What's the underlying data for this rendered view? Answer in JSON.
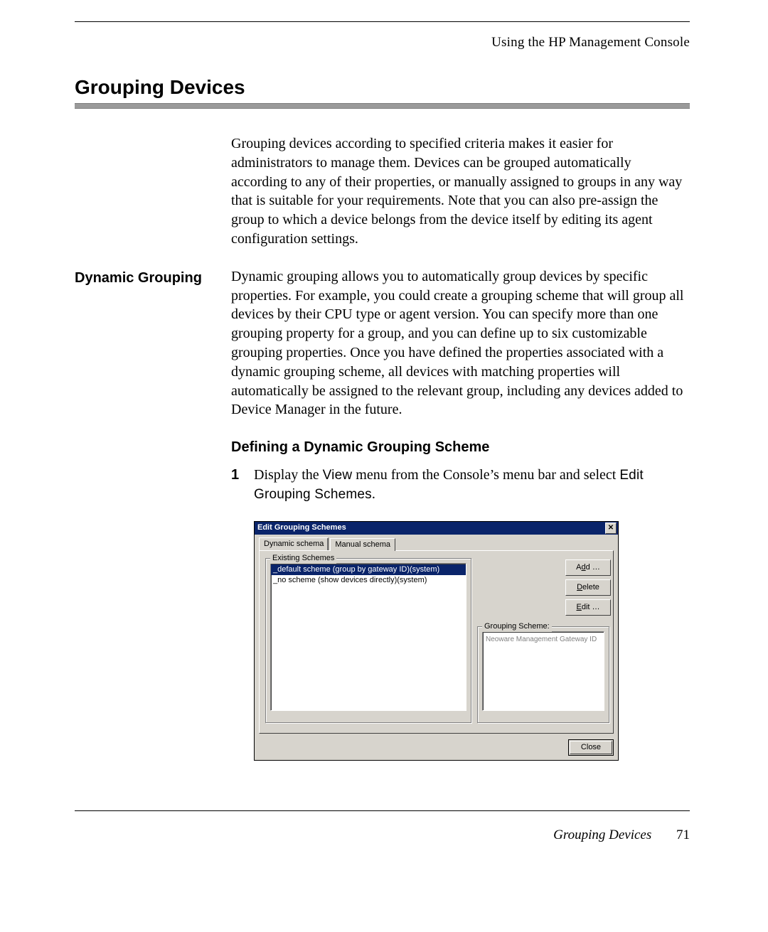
{
  "running_head": "Using the HP Management Console",
  "page_title": "Grouping Devices",
  "intro_para": "Grouping devices according to specified criteria makes it easier for administrators to manage them. Devices can be grouped automatically according to any of their properties, or manually assigned to groups in any way that is suitable for your requirements. Note that you can also pre-assign the group to which a device belongs from the device itself by editing its agent configuration settings.",
  "section": {
    "label": "Dynamic Grouping",
    "body": "Dynamic grouping allows you to automatically group devices by specific properties. For example, you could create a grouping scheme that will group all devices by their CPU type or agent version. You can specify more than one grouping property for a group, and you can define up to six customizable grouping properties. Once you have defined the properties associated with a dynamic grouping scheme, all devices with matching properties will automatically be assigned to the relevant group, including any devices added to Device Manager in the future."
  },
  "subhead": "Defining a Dynamic Grouping Scheme",
  "step1": {
    "num": "1",
    "pre": "Display the ",
    "view": "View",
    "mid": " menu from the Console’s menu bar and select ",
    "cmd": "Edit Grouping Schemes",
    "post": "."
  },
  "dialog": {
    "title": "Edit Grouping Schemes",
    "tabs": {
      "dynamic": "Dynamic schema",
      "manual": "Manual schema"
    },
    "existing_legend": "Existing Schemes",
    "schemes": [
      "_default scheme (group by gateway ID)(system)",
      "_no scheme (show devices directly)(system)"
    ],
    "buttons": {
      "add_pre": "A",
      "add_ul": "d",
      "add_post": "d …",
      "del_ul": "D",
      "del_post": "elete",
      "edit_ul": "E",
      "edit_post": "dit …",
      "close_ul": "C",
      "close_post": "lose"
    },
    "scheme_legend": "Grouping Scheme:",
    "scheme_value": "Neoware Management Gateway ID"
  },
  "footer": {
    "title": "Grouping Devices",
    "page": "71"
  }
}
